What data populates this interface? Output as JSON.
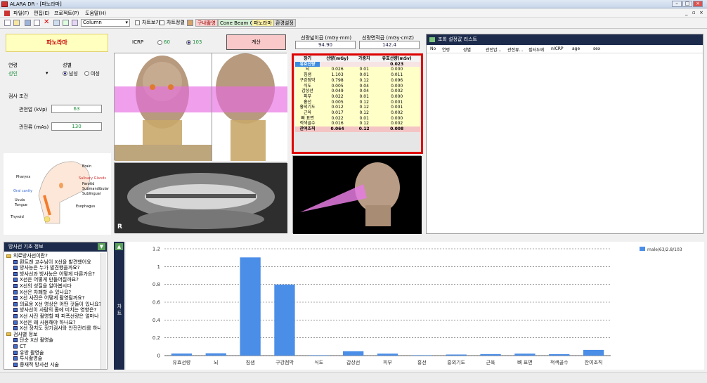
{
  "window": {
    "title": "ALARA DR - [파노라마]"
  },
  "menu": [
    "파일(F)",
    "편집(E)",
    "프로젝트(P)",
    "도움말(H)"
  ],
  "toolbar": {
    "chart_type": "Column",
    "chart_view": "차트보기",
    "chart_align": "차트정렬",
    "tags": [
      "구내촬영",
      "Cone Beam CT",
      "파노라마",
      "환경설정"
    ]
  },
  "left": {
    "mode_title": "파노라마",
    "age_label": "연령",
    "age_value": "성인",
    "sex_label": "성별",
    "sex_male": "남성",
    "sex_female": "여성",
    "exam_label": "검사 조건",
    "kvp_label": "관전압 (kVp)",
    "kvp_value": "63",
    "mas_label": "관전류 (mAs)",
    "mas_value": "130"
  },
  "icrp": {
    "label": "ICRP",
    "opt1": "60",
    "opt2": "103",
    "calc": "계산"
  },
  "top_values": {
    "dap_label": "선량넓이곱 (mGy·mm)",
    "dap_value": "94.90",
    "dap2_label": "선량면적곱 (mGy·cmZ)",
    "dap2_value": "142.4"
  },
  "dose_table": {
    "headers": [
      "장기",
      "선량(mGy)",
      "가중치",
      "유효선량(mSv)"
    ],
    "rows": [
      [
        "유효선량",
        "",
        "",
        "0.023"
      ],
      [
        "뇌",
        "0.026",
        "0.01",
        "0.000"
      ],
      [
        "침샘",
        "1.103",
        "0.01",
        "0.011"
      ],
      [
        "구강점막",
        "0.798",
        "0.12",
        "0.096"
      ],
      [
        "식도",
        "0.005",
        "0.04",
        "0.000"
      ],
      [
        "갑상선",
        "0.049",
        "0.04",
        "0.002"
      ],
      [
        "피부",
        "0.022",
        "0.01",
        "0.000"
      ],
      [
        "흉선",
        "0.005",
        "0.12",
        "0.001"
      ],
      [
        "흉외기도",
        "0.012",
        "0.12",
        "0.001"
      ],
      [
        "근육",
        "0.017",
        "0.12",
        "0.002"
      ],
      [
        "뼈 표면",
        "0.022",
        "0.01",
        "0.000"
      ],
      [
        "적색골수",
        "0.016",
        "0.12",
        "0.002"
      ],
      [
        "잔여조직",
        "0.064",
        "0.12",
        "0.008"
      ]
    ]
  },
  "list_panel": {
    "title": "조회 설정값 리스트",
    "columns": [
      "No",
      "연령",
      "성별",
      "관전압...",
      "관전류...",
      "필터두께",
      "nICRP",
      "age",
      "sex"
    ]
  },
  "anatomy": {
    "labels": [
      "Brain",
      "Pharynx",
      "Salivary Glands",
      "Parotid",
      "Submandibular",
      "Sublingual",
      "Oral cavity",
      "Uvula",
      "Tongue",
      "Esophagus",
      "Thyroid"
    ]
  },
  "xray": {
    "marker": "R"
  },
  "info_panel": {
    "title": "방사선 기초 정보",
    "tree": [
      {
        "t": "f",
        "label": "의료방사선이란?"
      },
      {
        "t": "i",
        "label": "뢴트겐 교수님이 X선을 발견했어요"
      },
      {
        "t": "i",
        "label": "방사능은 누가 발견했을까요?"
      },
      {
        "t": "i",
        "label": "방사선과 방사능은 어떻게 다른가요?"
      },
      {
        "t": "i",
        "label": "X선은 어떻게 만들어질까요?"
      },
      {
        "t": "i",
        "label": "X선의 성질을 알아봅시다"
      },
      {
        "t": "i",
        "label": "X선은 차폐할 수 있나요?"
      },
      {
        "t": "i",
        "label": "X선 사진은 어떻게 촬영될까요?"
      },
      {
        "t": "i",
        "label": "의료용 X선 영상은 어떤 것들이 있나요?"
      },
      {
        "t": "i",
        "label": "방사선이 사람의 몸에 미치는 영향은?"
      },
      {
        "t": "i",
        "label": "X선 사진 촬영할 때 피폭선량은 얼마나"
      },
      {
        "t": "i",
        "label": "X선은 왜 사용해야 하나요?"
      },
      {
        "t": "i",
        "label": "X선 장치도 정기검사와 안전관리를 하나"
      },
      {
        "t": "f",
        "label": "검사별 정보"
      },
      {
        "t": "i",
        "label": "단순 X선 촬영술"
      },
      {
        "t": "i",
        "label": "CT"
      },
      {
        "t": "i",
        "label": "유방 촬영술"
      },
      {
        "t": "i",
        "label": "투시촬영술"
      },
      {
        "t": "i",
        "label": "중재적 방사선 시술"
      }
    ]
  },
  "side_tab": "차트",
  "chart_data": {
    "type": "bar",
    "categories": [
      "유효선량",
      "뇌",
      "침샘",
      "구강점막",
      "식도",
      "갑상선",
      "피부",
      "흉선",
      "흉외기도",
      "근육",
      "뼈 표면",
      "적색골수",
      "잔여조직"
    ],
    "series": [
      {
        "name": "male/63/2.8/103",
        "values": [
          0.023,
          0.026,
          1.103,
          0.798,
          0.005,
          0.049,
          0.022,
          0.005,
          0.012,
          0.017,
          0.022,
          0.016,
          0.064
        ]
      }
    ],
    "ylim": [
      0,
      1.2
    ],
    "yticks": [
      "0",
      "0.2",
      "0.4",
      "0.6",
      "0.8",
      "1",
      "1.2"
    ],
    "grid": true,
    "legend": "top-right",
    "color": "#4a8ee8"
  }
}
